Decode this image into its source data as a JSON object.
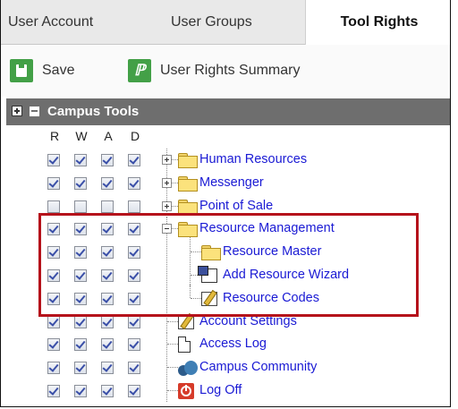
{
  "tabs": [
    {
      "label": "User Account",
      "active": false
    },
    {
      "label": "User Groups",
      "active": false
    },
    {
      "label": "Tool Rights",
      "active": true
    }
  ],
  "toolbar": {
    "save_label": "Save",
    "summary_label": "User Rights Summary",
    "summary_glyph": "ℙ"
  },
  "tree_header": {
    "title": "Campus Tools"
  },
  "columns": [
    "R",
    "W",
    "A",
    "D"
  ],
  "rows": [
    {
      "label": "Human Resources",
      "icon": "folder-icon",
      "rwad": [
        true,
        true,
        true,
        true
      ]
    },
    {
      "label": "Messenger",
      "icon": "folder-icon",
      "rwad": [
        true,
        true,
        true,
        true
      ]
    },
    {
      "label": "Point of Sale",
      "icon": "folder-icon",
      "rwad": [
        false,
        false,
        false,
        false
      ]
    },
    {
      "label": "Resource Management",
      "icon": "folder-icon",
      "rwad": [
        true,
        true,
        true,
        true
      ]
    },
    {
      "label": "Resource Master",
      "icon": "folder-icon",
      "rwad": [
        true,
        true,
        true,
        true
      ]
    },
    {
      "label": "Add Resource Wizard",
      "icon": "wizard-icon",
      "rwad": [
        true,
        true,
        true,
        true
      ]
    },
    {
      "label": "Resource Codes",
      "icon": "edit-document-icon",
      "rwad": [
        true,
        true,
        true,
        true
      ]
    },
    {
      "label": "Account Settings",
      "icon": "edit-document-icon",
      "rwad": [
        true,
        true,
        true,
        true
      ]
    },
    {
      "label": "Access Log",
      "icon": "document-icon",
      "rwad": [
        true,
        true,
        true,
        true
      ]
    },
    {
      "label": "Campus Community",
      "icon": "community-icon",
      "rwad": [
        true,
        true,
        true,
        true
      ]
    },
    {
      "label": "Log Off",
      "icon": "power-off-icon",
      "rwad": [
        true,
        true,
        true,
        true
      ]
    }
  ],
  "colors": {
    "highlight": "#b5121b",
    "link": "#1a1ad4",
    "header_bar": "#6e6e6e",
    "accent_green": "#43a047"
  }
}
